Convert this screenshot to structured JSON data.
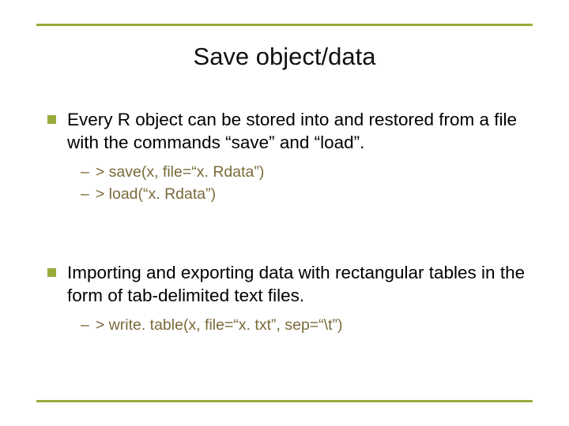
{
  "title": "Save object/data",
  "section1": {
    "text": "Every R object can be stored into and restored from a file with the commands “save” and “load”.",
    "items": [
      "> save(x, file=“x. Rdata”)",
      "> load(“x. Rdata”)"
    ]
  },
  "section2": {
    "text": "Importing and exporting data with rectangular tables in the form of tab-delimited text files.",
    "items": [
      "> write. table(x, file=“x. txt”, sep=“\\t”)"
    ]
  }
}
